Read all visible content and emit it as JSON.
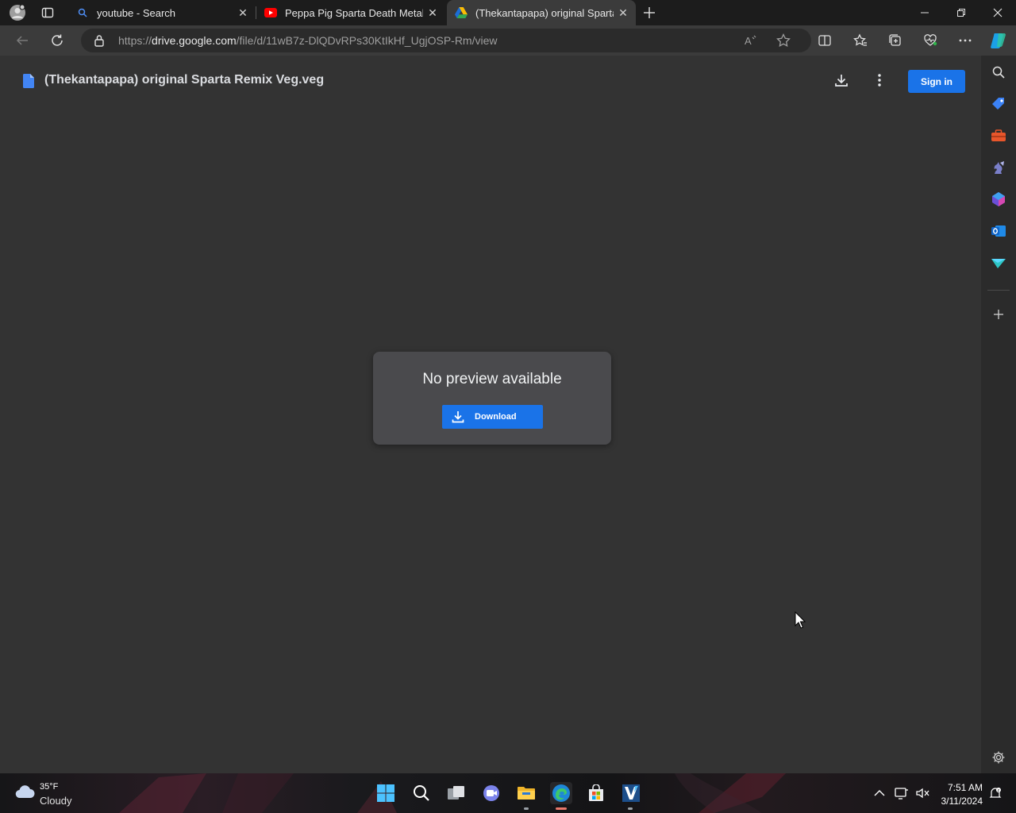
{
  "browser": {
    "tabs": [
      {
        "title": "youtube - Search",
        "icon": "search-icon",
        "active": false
      },
      {
        "title": "Peppa Pig Sparta Death Metal Re",
        "icon": "youtube-icon",
        "active": false
      },
      {
        "title": "(Thekantapapa) original Sparta R",
        "icon": "google-drive-icon",
        "active": true
      }
    ],
    "address": {
      "scheme": "https://",
      "host": "drive.google.com",
      "path": "/file/d/11wB7z-DlQDvRPs30KtIkHf_UgjOSP-Rm/view"
    }
  },
  "drive": {
    "file_title": "(Thekantapapa) original Sparta Remix Veg.veg",
    "sign_in_label": "Sign in",
    "no_preview_text": "No preview available",
    "download_label": "Download"
  },
  "taskbar": {
    "weather_temp": "35°F",
    "weather_condition": "Cloudy",
    "time": "7:51 AM",
    "date": "3/11/2024"
  },
  "colors": {
    "accent_blue": "#1a73e8",
    "page_bg": "#333333",
    "card_bg": "#4a4a4d"
  }
}
